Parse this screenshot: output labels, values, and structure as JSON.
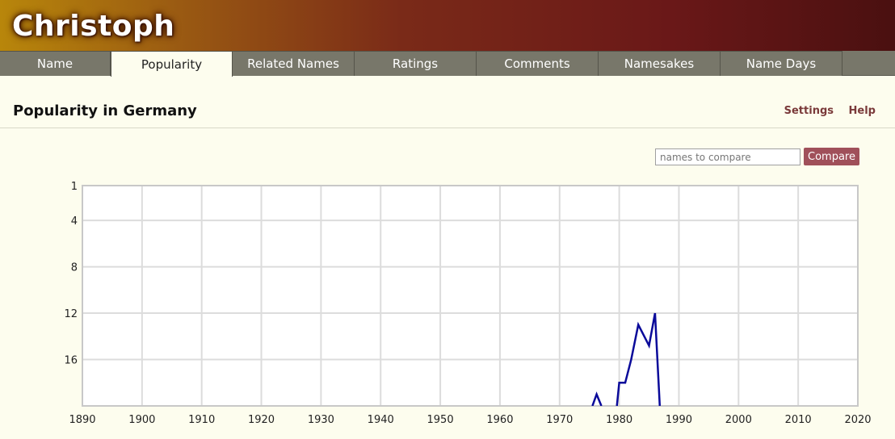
{
  "site": {
    "title": "Christoph"
  },
  "tabs": [
    {
      "label": "Name",
      "active": false
    },
    {
      "label": "Popularity",
      "active": true
    },
    {
      "label": "Related Names",
      "active": false
    },
    {
      "label": "Ratings",
      "active": false
    },
    {
      "label": "Comments",
      "active": false
    },
    {
      "label": "Namesakes",
      "active": false
    },
    {
      "label": "Name Days",
      "active": false
    }
  ],
  "section": {
    "title": "Popularity in Germany",
    "settings_label": "Settings",
    "help_label": "Help"
  },
  "compare": {
    "placeholder": "names to compare",
    "button_label": "Compare"
  },
  "colors": {
    "line": "#0a0a9a",
    "accent": "#a0505a"
  },
  "chart_data": {
    "type": "line",
    "title": "",
    "xlabel": "",
    "ylabel": "",
    "x_range": [
      1890,
      2020
    ],
    "y_range": [
      1,
      20
    ],
    "y_inverted": true,
    "grid": true,
    "x_ticks": [
      1890,
      1900,
      1910,
      1920,
      1930,
      1940,
      1950,
      1960,
      1970,
      1980,
      1990,
      2000,
      2010,
      2020
    ],
    "y_ticks": [
      1,
      4,
      8,
      12,
      16
    ],
    "series": [
      {
        "name": "Christoph",
        "points": [
          [
            1975.5,
            20
          ],
          [
            1976.2,
            19
          ],
          [
            1977.0,
            20
          ],
          [
            1979.6,
            20
          ],
          [
            1980.0,
            18
          ],
          [
            1981.0,
            18
          ],
          [
            1982.0,
            16
          ],
          [
            1983.2,
            13
          ],
          [
            1985.0,
            14.8
          ],
          [
            1986.0,
            12
          ],
          [
            1986.8,
            20
          ]
        ]
      }
    ]
  }
}
